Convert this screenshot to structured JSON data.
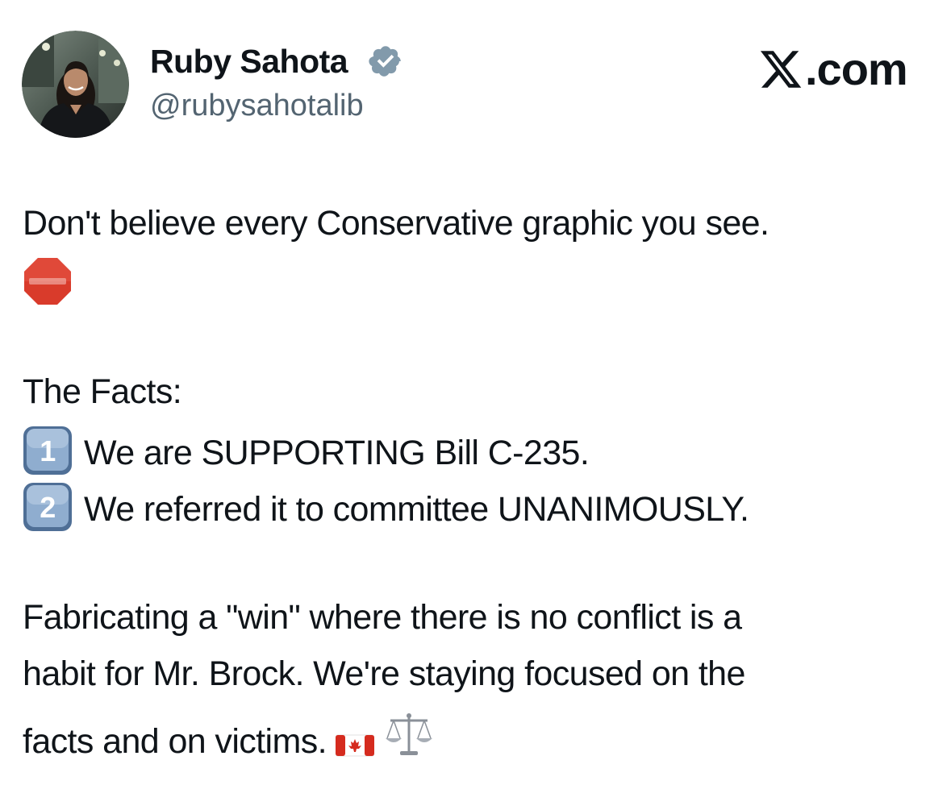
{
  "author": {
    "name": "Ruby Sahota",
    "handle": "@rubysahotalib",
    "verified": true,
    "avatar_icon": "profile-photo"
  },
  "brand": {
    "text": ".com",
    "icon": "x-logo-icon"
  },
  "tweet": {
    "line1": "Don't believe every Conservative graphic you see.",
    "stop_emoji": "stop-sign-icon",
    "facts_heading": "The Facts:",
    "fact1_number": "1",
    "fact1_text": "We are SUPPORTING Bill C-235.",
    "fact2_number": "2",
    "fact2_text": "We referred it to committee UNANIMOUSLY.",
    "closing_line1": "Fabricating a \"win\" where there is no conflict is a",
    "closing_line2": "habit for Mr. Brock. We're staying focused on the",
    "closing_line3": "facts and on victims.",
    "closing_emojis": [
      "canada-flag-icon",
      "balance-scale-icon"
    ]
  },
  "colors": {
    "text": "#0f1419",
    "secondary": "#536471",
    "verified_badge": "#829aab",
    "stop_red": "#d93b2b",
    "keycap_blue": "#6f8fb5"
  }
}
